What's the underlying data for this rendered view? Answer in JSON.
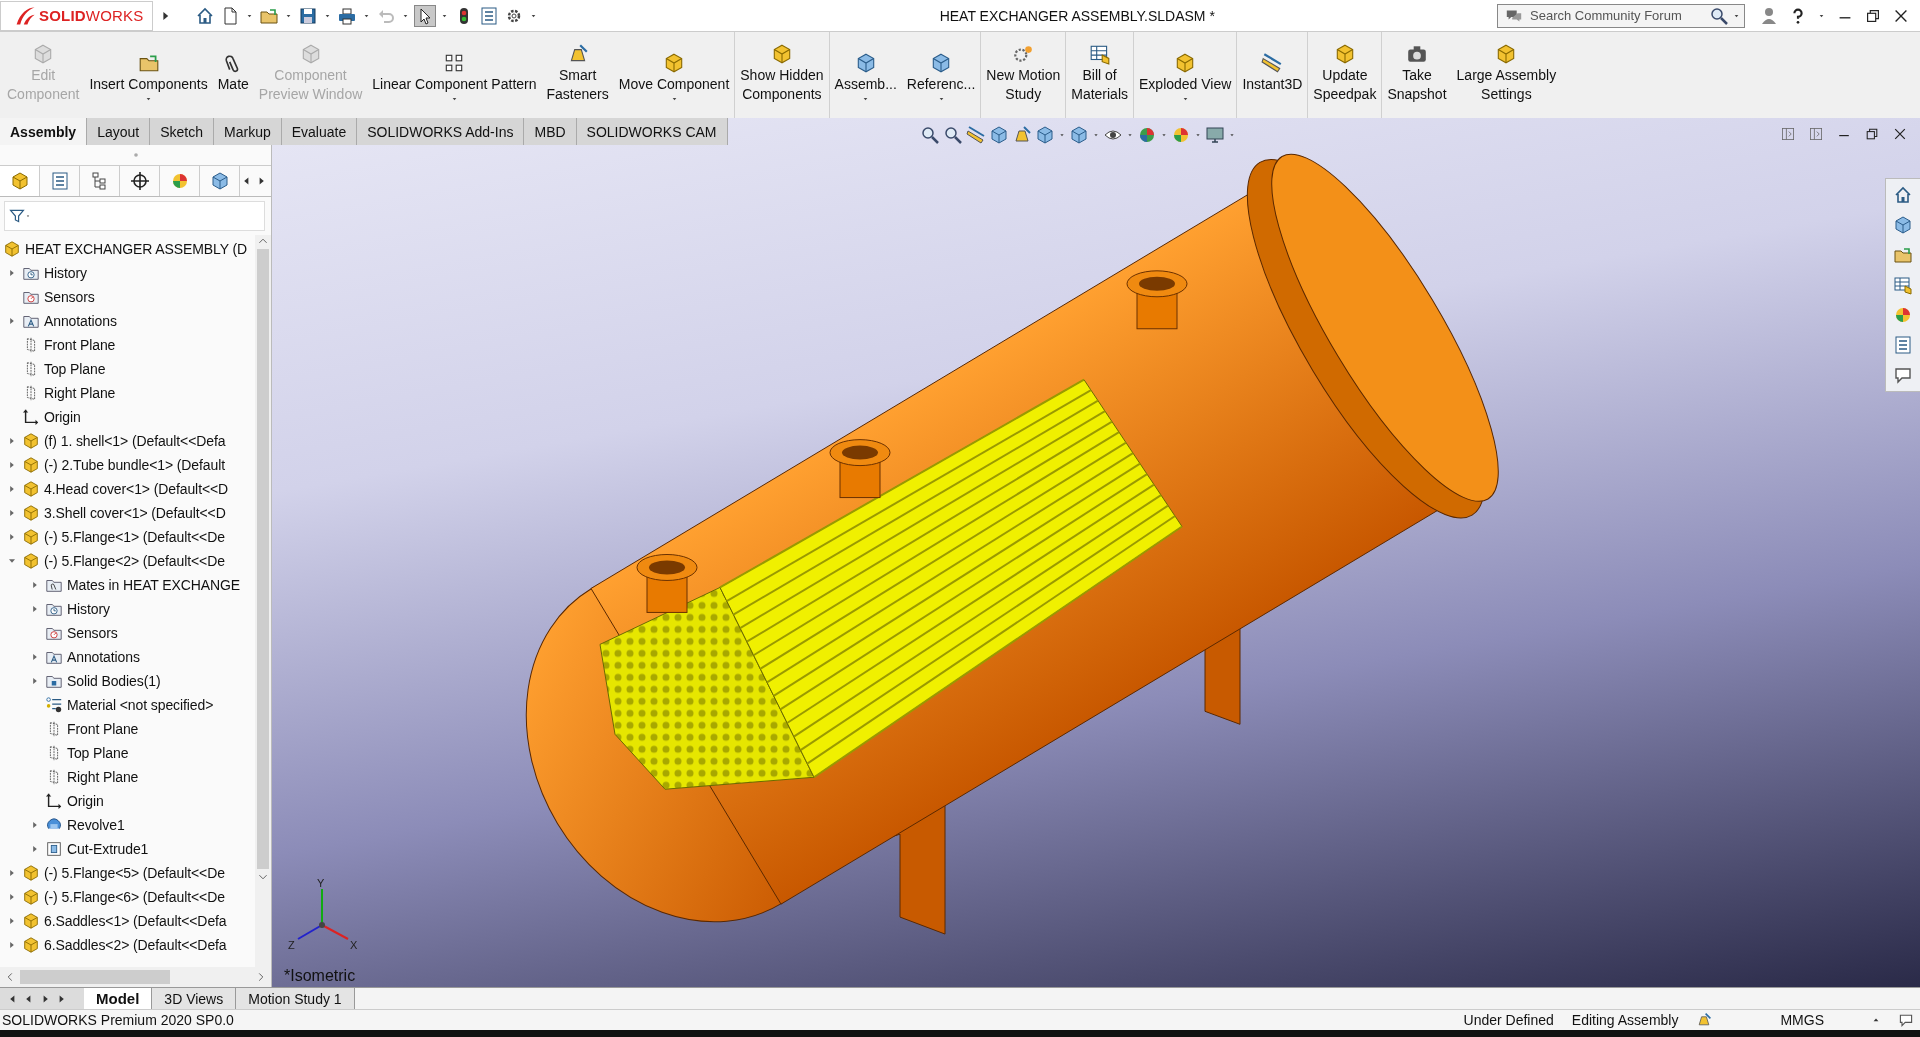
{
  "title_bar": {
    "logo": "**SOLID**WORKS",
    "title": "HEAT EXCHANGER ASSEMBLY.SLDASM *",
    "search": {
      "placeholder": "Search Community Forum"
    }
  },
  "command_groups": [
    [
      {
        "lines": [
          "Edit",
          "Component"
        ],
        "disabled": true,
        "dropdown": false
      },
      {
        "lines": [
          "Insert Components"
        ],
        "disabled": false,
        "dropdown": true
      },
      {
        "lines": [
          "Mate"
        ],
        "disabled": false,
        "dropdown": false
      },
      {
        "lines": [
          "Component",
          "Preview Window"
        ],
        "disabled": true,
        "dropdown": false
      },
      {
        "lines": [
          "Linear Component Pattern"
        ],
        "disabled": false,
        "dropdown": true
      },
      {
        "lines": [
          "Smart",
          "Fasteners"
        ],
        "disabled": false,
        "dropdown": false
      },
      {
        "lines": [
          "Move Component"
        ],
        "disabled": false,
        "dropdown": true
      }
    ],
    [
      {
        "lines": [
          "Show Hidden",
          "Components"
        ],
        "disabled": false,
        "dropdown": false
      }
    ],
    [
      {
        "lines": [
          "Assemb..."
        ],
        "disabled": false,
        "dropdown": true
      },
      {
        "lines": [
          "Referenc..."
        ],
        "disabled": false,
        "dropdown": true
      }
    ],
    [
      {
        "lines": [
          "New Motion",
          "Study"
        ],
        "disabled": false,
        "dropdown": false
      }
    ],
    [
      {
        "lines": [
          "Bill of",
          "Materials"
        ],
        "disabled": false,
        "dropdown": false
      }
    ],
    [
      {
        "lines": [
          "Exploded View"
        ],
        "disabled": false,
        "dropdown": true
      }
    ],
    [
      {
        "lines": [
          "Instant3D"
        ],
        "disabled": false,
        "dropdown": false
      }
    ],
    [
      {
        "lines": [
          "Update",
          "Speedpak"
        ],
        "disabled": false,
        "dropdown": false
      }
    ],
    [
      {
        "lines": [
          "Take",
          "Snapshot"
        ],
        "disabled": false,
        "dropdown": false
      },
      {
        "lines": [
          "Large Assembly",
          "Settings"
        ],
        "disabled": false,
        "dropdown": false
      }
    ]
  ],
  "tabs": [
    {
      "label": "Assembly",
      "selected": true
    },
    {
      "label": "Layout",
      "selected": false
    },
    {
      "label": "Sketch",
      "selected": false
    },
    {
      "label": "Markup",
      "selected": false
    },
    {
      "label": "Evaluate",
      "selected": false
    },
    {
      "label": "SOLIDWORKS Add-Ins",
      "selected": false
    },
    {
      "label": "MBD",
      "selected": false
    },
    {
      "label": "SOLIDWORKS CAM",
      "selected": false
    }
  ],
  "tree": {
    "label": "HEAT EXCHANGER ASSEMBLY  (D",
    "kind": "assembly",
    "children": [
      {
        "label": "History",
        "kind": "history",
        "expanded": false
      },
      {
        "label": "Sensors",
        "kind": "sensors"
      },
      {
        "label": "Annotations",
        "kind": "annotations",
        "expanded": false
      },
      {
        "label": "Front Plane",
        "kind": "plane"
      },
      {
        "label": "Top Plane",
        "kind": "plane"
      },
      {
        "label": "Right Plane",
        "kind": "plane"
      },
      {
        "label": "Origin",
        "kind": "origin"
      },
      {
        "label": "(f) 1. shell<1> (Default<<Defa",
        "kind": "part",
        "expanded": false
      },
      {
        "label": "(-) 2.Tube bundle<1> (Default",
        "kind": "part",
        "expanded": false
      },
      {
        "label": "4.Head cover<1> (Default<<D",
        "kind": "part",
        "expanded": false
      },
      {
        "label": "3.Shell cover<1> (Default<<D",
        "kind": "part",
        "expanded": false
      },
      {
        "label": "(-) 5.Flange<1> (Default<<De",
        "kind": "part",
        "expanded": false
      },
      {
        "label": "(-) 5.Flange<2> (Default<<De",
        "kind": "part",
        "expanded": true,
        "children": [
          {
            "label": "Mates in HEAT EXCHANGE",
            "kind": "mates",
            "expanded": false
          },
          {
            "label": "History",
            "kind": "history",
            "expanded": false
          },
          {
            "label": "Sensors",
            "kind": "sensors"
          },
          {
            "label": "Annotations",
            "kind": "annotations",
            "expanded": false
          },
          {
            "label": "Solid Bodies(1)",
            "kind": "bodies",
            "expanded": false
          },
          {
            "label": "Material <not specified>",
            "kind": "material"
          },
          {
            "label": "Front Plane",
            "kind": "plane"
          },
          {
            "label": "Top Plane",
            "kind": "plane"
          },
          {
            "label": "Right Plane",
            "kind": "plane"
          },
          {
            "label": "Origin",
            "kind": "origin"
          },
          {
            "label": "Revolve1",
            "kind": "revolve",
            "expanded": false
          },
          {
            "label": "Cut-Extrude1",
            "kind": "cut",
            "expanded": false
          }
        ]
      },
      {
        "label": "(-) 5.Flange<5> (Default<<De",
        "kind": "part",
        "expanded": false
      },
      {
        "label": "(-) 5.Flange<6> (Default<<De",
        "kind": "part",
        "expanded": false
      },
      {
        "label": "6.Saddles<1> (Default<<Defa",
        "kind": "part",
        "expanded": false
      },
      {
        "label": "6.Saddles<2> (Default<<Defa",
        "kind": "part",
        "expanded": false
      }
    ]
  },
  "viewport": {
    "view_name": "*Isometric",
    "triad": [
      "X",
      "Y",
      "Z"
    ]
  },
  "bottom_tabs": [
    {
      "label": "Model",
      "selected": true
    },
    {
      "label": "3D Views",
      "selected": false
    },
    {
      "label": "Motion Study 1",
      "selected": false
    }
  ],
  "status_bar": {
    "product": "SOLIDWORKS Premium 2020 SP0.0",
    "items": [
      "Under Defined",
      "Editing Assembly"
    ],
    "units": "MMGS"
  }
}
